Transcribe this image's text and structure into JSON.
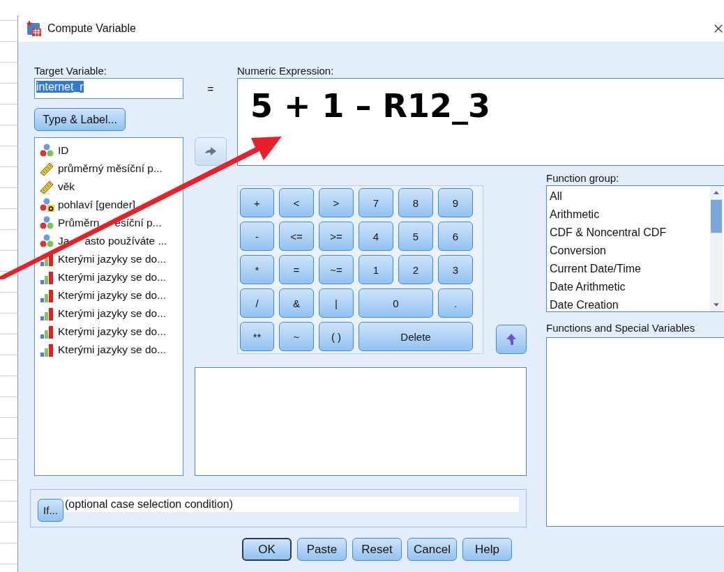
{
  "window": {
    "title": "Compute Variable"
  },
  "target": {
    "label": "Target Variable:",
    "value": "internet_r",
    "text_selected": true
  },
  "equals": "=",
  "type_label_button": "Type & Label...",
  "variables": [
    {
      "name": "ID",
      "kind": "nominal"
    },
    {
      "name": "průměrný měsíční p...",
      "kind": "scale"
    },
    {
      "name": "věk",
      "kind": "scale"
    },
    {
      "name": "pohlaví  [gender]",
      "kind": "nominal-string"
    },
    {
      "name": "Průměrn",
      "name_rest": "esíční p...",
      "kind": "nominal"
    },
    {
      "name": "Ja",
      "name_rest": "asto používáte ...",
      "kind": "nominal"
    },
    {
      "name": "Kterými jazyky se do...",
      "kind": "ordinal"
    },
    {
      "name": "Kterými jazyky se do...",
      "kind": "ordinal"
    },
    {
      "name": "Kterými jazyky se do...",
      "kind": "ordinal"
    },
    {
      "name": "Kterými jazyky se do...",
      "kind": "ordinal"
    },
    {
      "name": "Kterými jazyky se do...",
      "kind": "ordinal"
    },
    {
      "name": "Kterými jazyky se do...",
      "kind": "ordinal"
    }
  ],
  "expression": {
    "label": "Numeric Expression:",
    "value": "5 + 1 – R12_3"
  },
  "keypad": [
    {
      "label": "+",
      "kind": "key"
    },
    {
      "label": "<",
      "kind": "key"
    },
    {
      "label": ">",
      "kind": "key"
    },
    {
      "label": "7",
      "kind": "key"
    },
    {
      "label": "8",
      "kind": "key"
    },
    {
      "label": "9",
      "kind": "key"
    },
    {
      "label": "-",
      "kind": "key"
    },
    {
      "label": "<=",
      "kind": "key"
    },
    {
      "label": ">=",
      "kind": "key"
    },
    {
      "label": "4",
      "kind": "key"
    },
    {
      "label": "5",
      "kind": "key"
    },
    {
      "label": "6",
      "kind": "key"
    },
    {
      "label": "*",
      "kind": "key"
    },
    {
      "label": "=",
      "kind": "key"
    },
    {
      "label": "~=",
      "kind": "key"
    },
    {
      "label": "1",
      "kind": "key"
    },
    {
      "label": "2",
      "kind": "key"
    },
    {
      "label": "3",
      "kind": "key"
    },
    {
      "label": "/",
      "kind": "key"
    },
    {
      "label": "&",
      "kind": "key"
    },
    {
      "label": "|",
      "kind": "key"
    },
    {
      "label": "0",
      "kind": "wide"
    },
    {
      "label": ".",
      "kind": "key"
    },
    {
      "label": "**",
      "kind": "key"
    },
    {
      "label": "~",
      "kind": "key"
    },
    {
      "label": "( )",
      "kind": "key"
    },
    {
      "label": "Delete",
      "kind": "wider"
    }
  ],
  "function_group": {
    "label": "Function group:",
    "items": [
      "All",
      "Arithmetic",
      "CDF & Noncentral CDF",
      "Conversion",
      "Current Date/Time",
      "Date Arithmetic",
      "Date Creation"
    ]
  },
  "functions": {
    "label": "Functions and Special Variables"
  },
  "if_condition": {
    "button": "If...",
    "text": "(optional case selection condition)"
  },
  "buttons": [
    {
      "label": "OK",
      "default": true
    },
    {
      "label": "Paste",
      "default": false
    },
    {
      "label": "Reset",
      "default": false
    },
    {
      "label": "Cancel",
      "default": false
    },
    {
      "label": "Help",
      "default": false
    }
  ]
}
